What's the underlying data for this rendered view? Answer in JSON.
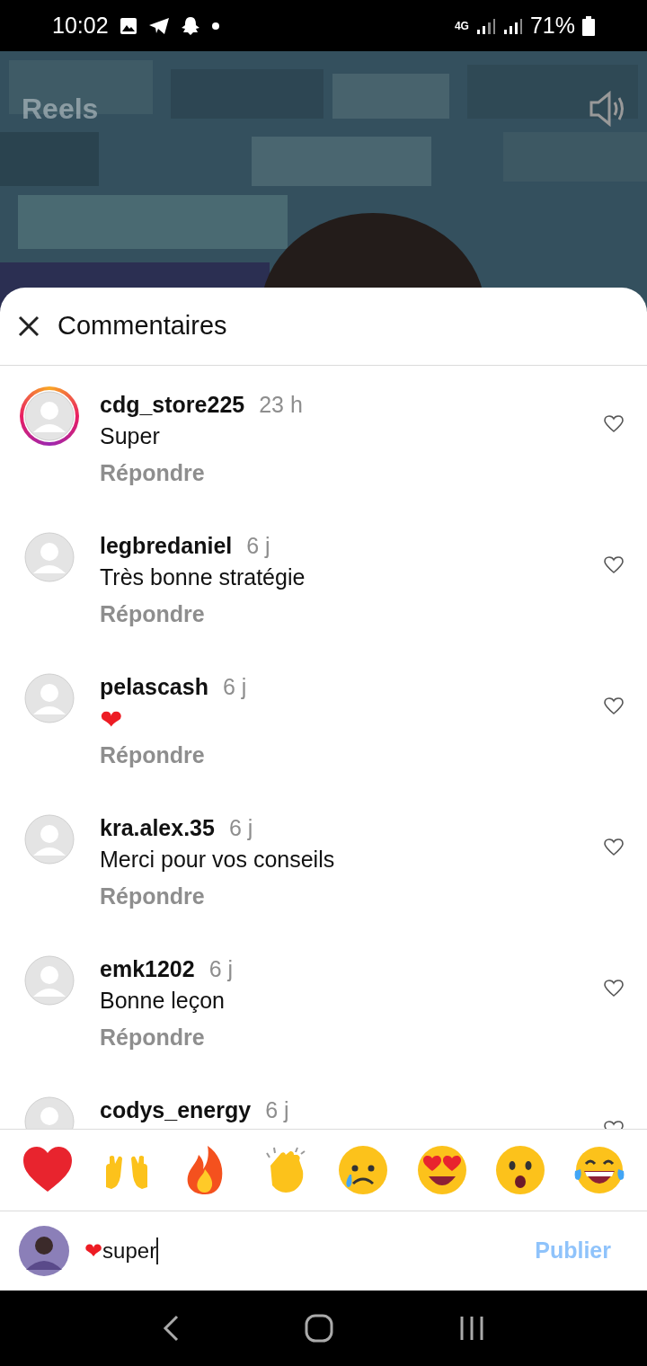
{
  "status_bar": {
    "time": "10:02",
    "network": "4G",
    "battery": "71%"
  },
  "reel": {
    "title": "Reels"
  },
  "sheet": {
    "title": "Commentaires"
  },
  "comments": [
    {
      "username": "cdg_store225",
      "time": "23 h",
      "text": "Super",
      "reply": "Répondre",
      "story_ring": true,
      "liked": false
    },
    {
      "username": "legbredaniel",
      "time": "6 j",
      "text": "Très bonne stratégie",
      "reply": "Répondre",
      "story_ring": false,
      "liked": false
    },
    {
      "username": "pelascash",
      "time": "6 j",
      "text": "❤",
      "reply": "Répondre",
      "story_ring": false,
      "liked": false,
      "kind": "emoji"
    },
    {
      "username": "kra.alex.35",
      "time": "6 j",
      "text": "Merci pour vos conseils",
      "reply": "Répondre",
      "story_ring": false,
      "liked": false
    },
    {
      "username": "emk1202",
      "time": "6 j",
      "text": "Bonne leçon",
      "reply": "Répondre",
      "story_ring": false,
      "liked": false
    },
    {
      "username": "codys_energy",
      "time": "6 j",
      "story_ring": false,
      "liked": false
    }
  ],
  "composer": {
    "value_emoji": "❤",
    "value": "super",
    "publish": "Publier",
    "publish_disabled": true
  }
}
